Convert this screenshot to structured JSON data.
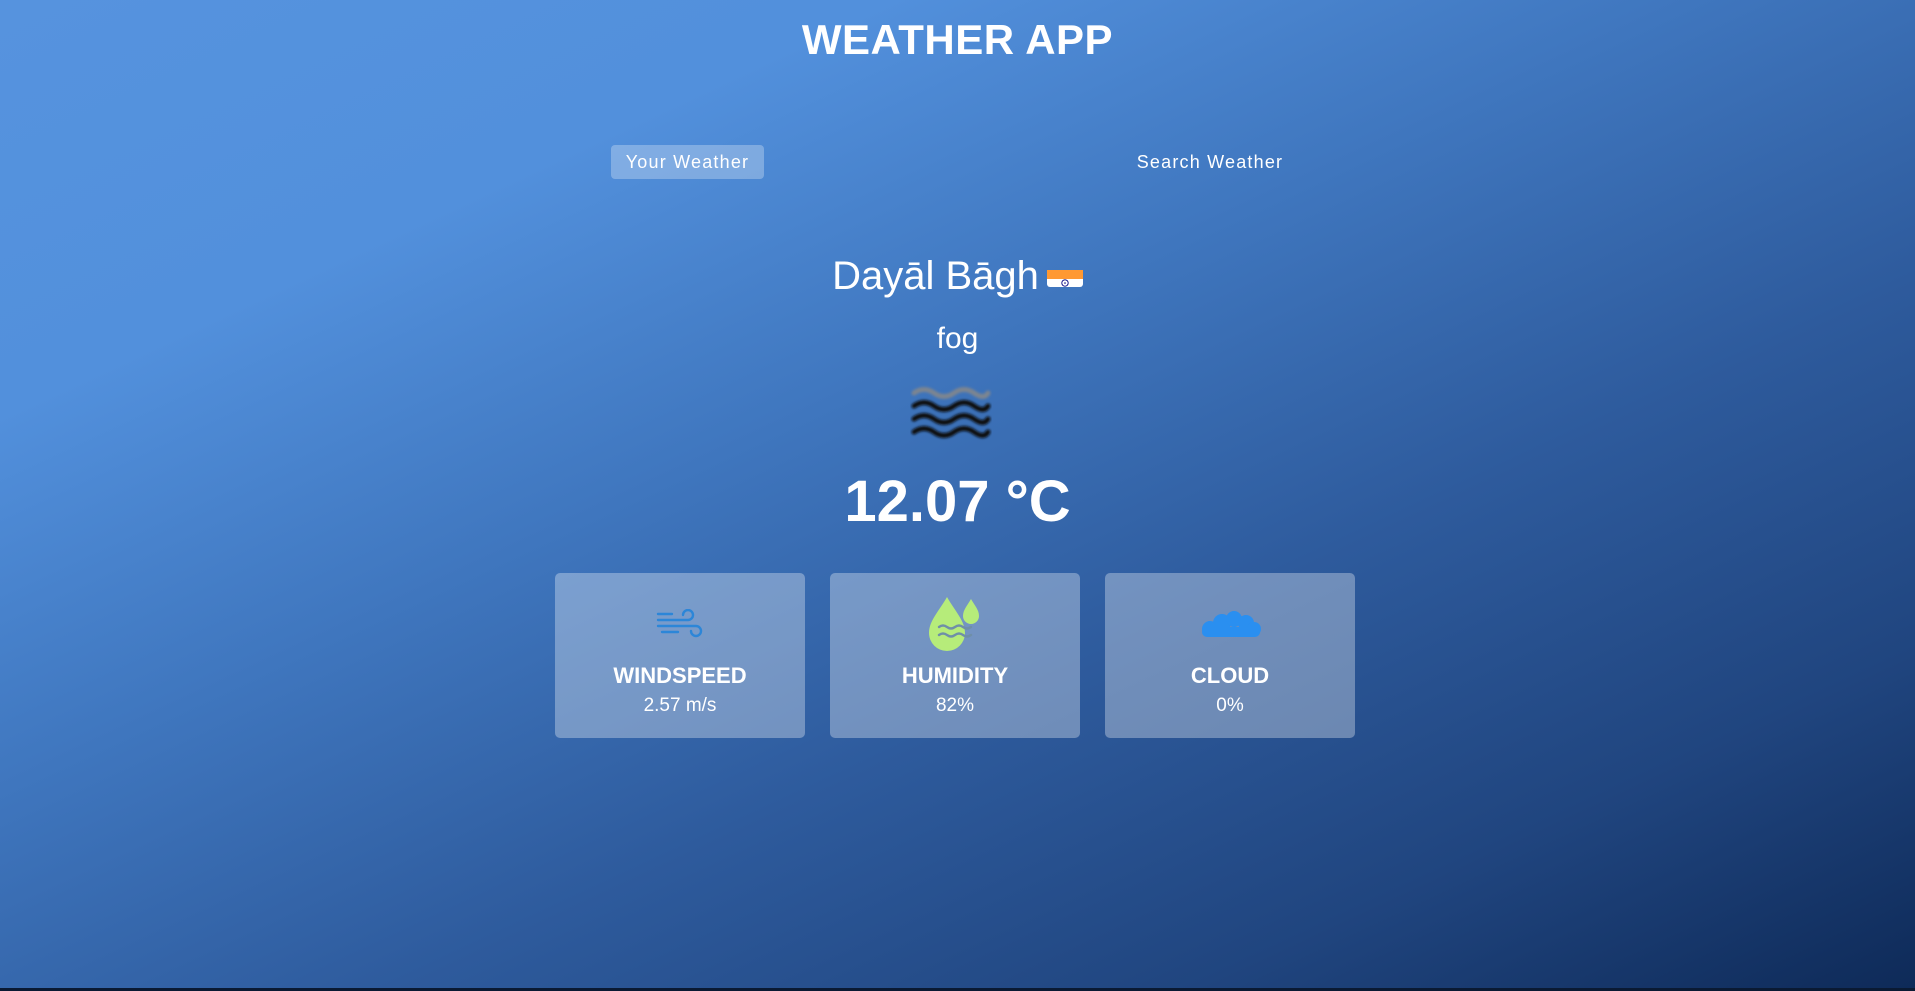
{
  "app": {
    "title": "WEATHER APP"
  },
  "tabs": [
    {
      "label": "Your Weather",
      "active": true
    },
    {
      "label": "Search Weather",
      "active": false
    }
  ],
  "current": {
    "city": "Dayāl Bāgh",
    "country_flag_icon": "india-flag-icon",
    "condition": "fog",
    "condition_icon": "fog-icon",
    "temperature": "12.07 °C"
  },
  "cards": [
    {
      "label": "WINDSPEED",
      "value": "2.57 m/s",
      "icon": "wind-icon"
    },
    {
      "label": "HUMIDITY",
      "value": "82%",
      "icon": "humidity-icon"
    },
    {
      "label": "CLOUD",
      "value": "0%",
      "icon": "cloud-icon"
    }
  ],
  "colors": {
    "background_top": "#5693de",
    "background_bottom": "#0e2a58",
    "wind_icon": "#2c86d8",
    "humidity_icon": "#b6ec7a",
    "cloud_icon": "#2a8ff0"
  }
}
